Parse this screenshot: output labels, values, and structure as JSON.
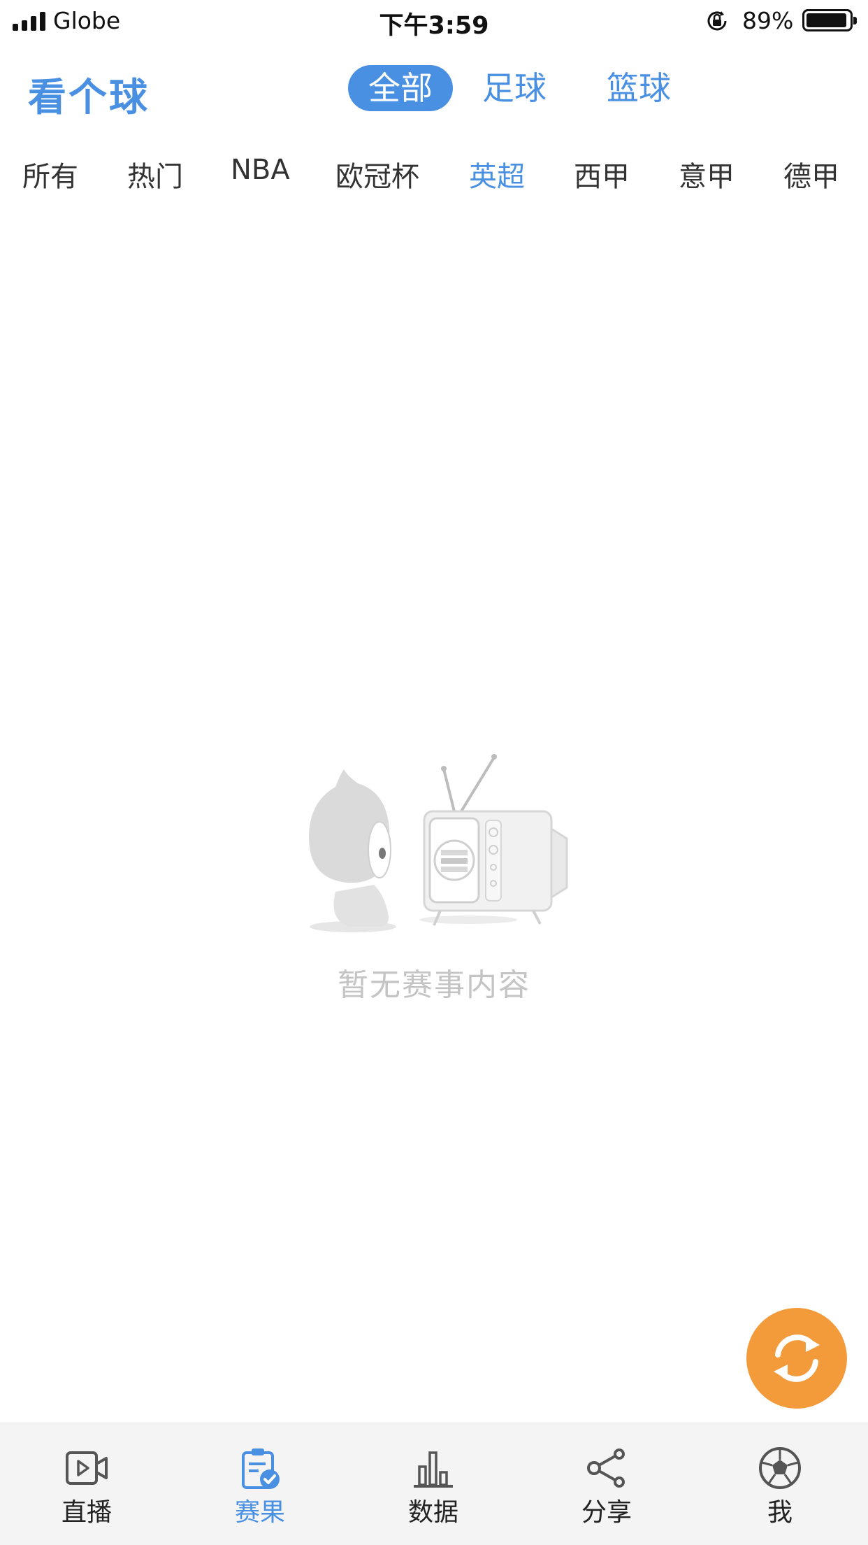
{
  "status_bar": {
    "carrier": "Globe",
    "time": "下午3:59",
    "battery": "89%"
  },
  "header": {
    "brand": "看个球",
    "sport_tabs": [
      {
        "label": "全部",
        "active": true
      },
      {
        "label": "足球",
        "active": false
      },
      {
        "label": "篮球",
        "active": false
      }
    ]
  },
  "league_tabs": [
    {
      "label": "所有",
      "active": false
    },
    {
      "label": "热门",
      "active": false
    },
    {
      "label": "NBA",
      "active": false
    },
    {
      "label": "欧冠杯",
      "active": false
    },
    {
      "label": "英超",
      "active": true
    },
    {
      "label": "西甲",
      "active": false
    },
    {
      "label": "意甲",
      "active": false
    },
    {
      "label": "德甲",
      "active": false
    }
  ],
  "empty_state": {
    "message": "暂无赛事内容"
  },
  "bottom_nav": [
    {
      "label": "直播",
      "icon": "video-play-icon",
      "active": false
    },
    {
      "label": "赛果",
      "icon": "clipboard-check-icon",
      "active": true
    },
    {
      "label": "数据",
      "icon": "bar-chart-icon",
      "active": false
    },
    {
      "label": "分享",
      "icon": "share-icon",
      "active": false
    },
    {
      "label": "我",
      "icon": "soccer-ball-icon",
      "active": false
    }
  ],
  "colors": {
    "accent": "#4a90e2",
    "fab": "#f39b3b",
    "empty_text": "#c4c4c4"
  }
}
